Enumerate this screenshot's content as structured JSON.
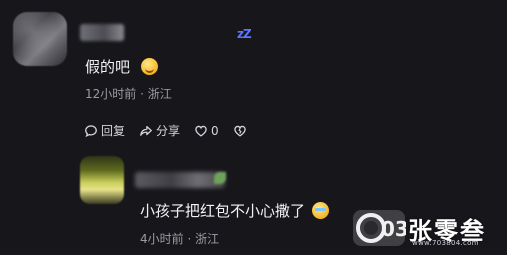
{
  "comments": [
    {
      "text": "假的吧",
      "meta": "12小时前 · 浙江",
      "actions": {
        "reply": "回复",
        "share": "分享",
        "like_count": "0"
      },
      "status_glyph": "zZ"
    },
    {
      "text": "小孩子把红包不小心撒了",
      "meta": "4小时前 · 浙江"
    }
  ],
  "watermark": {
    "title": "张零叁",
    "url": "www.703804.com",
    "logo_text": "03"
  },
  "icons": {
    "reply": "comment-bubble-icon",
    "share": "share-arrow-icon",
    "like": "heart-icon",
    "dislike": "broken-heart-icon",
    "emoji_1": "smiling-face-emoji",
    "emoji_2": "crying-laughing-emoji"
  },
  "colors": {
    "background": "#16161b",
    "text": "#f2f2f6",
    "meta": "#9b9ba3",
    "status_glyph": "#5c76ff"
  }
}
